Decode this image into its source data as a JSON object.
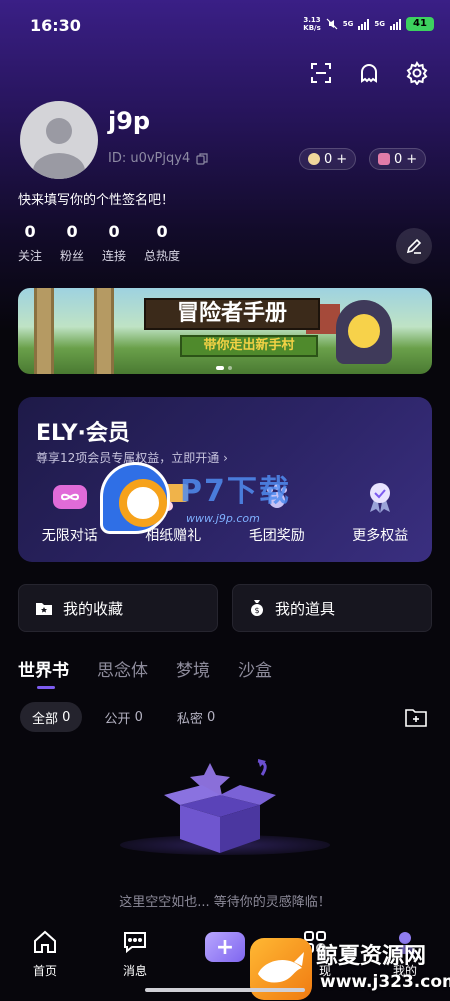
{
  "status_bar": {
    "time": "16:30",
    "net_speed": "3.13",
    "net_unit": "KB/s",
    "sig1": "5G",
    "sig2": "5G",
    "battery": "41"
  },
  "profile": {
    "username": "j9p",
    "id_text": "ID: u0vPjqy4",
    "coin1_value": "0",
    "coin2_value": "0",
    "signature": "快来填写你的个性签名吧！",
    "stats": [
      {
        "num": "0",
        "label": "关注"
      },
      {
        "num": "0",
        "label": "粉丝"
      },
      {
        "num": "0",
        "label": "连接"
      },
      {
        "num": "0",
        "label": "总热度"
      }
    ]
  },
  "banner": {
    "title": "冒险者手册",
    "subtitle": "带你走出新手村"
  },
  "member": {
    "brand": "ELY·会员",
    "desc": "尊享12项会员专属权益，立即开通 ›",
    "benefits": [
      {
        "label": "无限对话",
        "icon": "infinity-icon"
      },
      {
        "label": "相纸赠礼",
        "icon": "nft-icon"
      },
      {
        "label": "毛团奖励",
        "icon": "paw-icon"
      },
      {
        "label": "更多权益",
        "icon": "medal-icon"
      }
    ]
  },
  "watermark": {
    "text": "P7下载",
    "url": "www.j9p.com"
  },
  "actions": {
    "favorites": "我的收藏",
    "items": "我的道具"
  },
  "tabs": [
    "世界书",
    "思念体",
    "梦境",
    "沙盒"
  ],
  "filters": [
    {
      "label": "全部",
      "count": "0"
    },
    {
      "label": "公开",
      "count": "0"
    },
    {
      "label": "私密",
      "count": "0"
    }
  ],
  "empty_text": "这里空空如也... 等待你的灵感降临！",
  "bottom_nav": {
    "home": "首页",
    "messages": "消息",
    "discover": "现",
    "mine": "我的"
  },
  "corner_watermark": {
    "title": "鲸夏资源网",
    "url": "www.j323.com"
  },
  "colors": {
    "accent": "#7d5cf0",
    "battery": "#3dd15f"
  }
}
